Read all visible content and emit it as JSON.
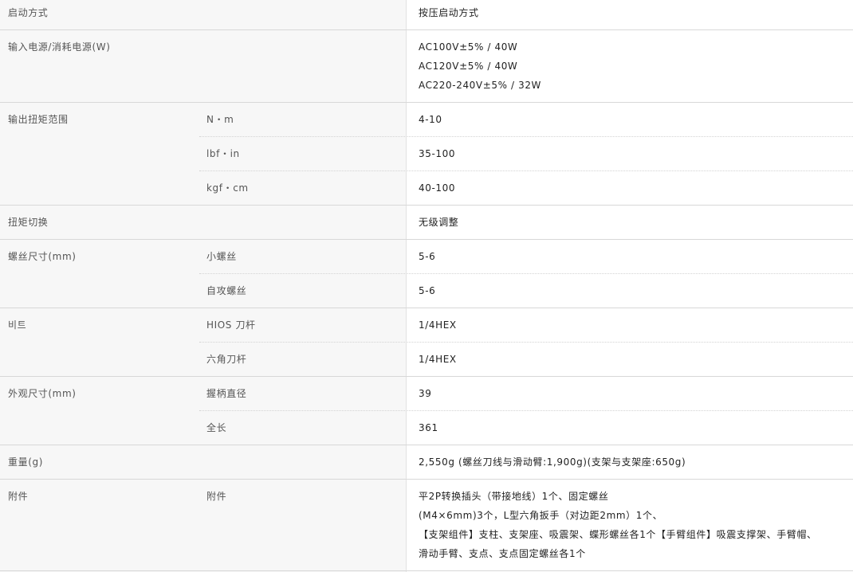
{
  "rows": {
    "start_method": {
      "label": "启动方式",
      "value": "按压启动方式"
    },
    "power": {
      "label": "输入电源/消耗电源(W)",
      "values": [
        "AC100V±5% / 40W",
        "AC120V±5% / 40W",
        "AC220-240V±5% / 32W"
      ]
    },
    "torque_range": {
      "label": "输出扭矩范围",
      "subs": [
        {
          "label": "N・m",
          "value": "4-10"
        },
        {
          "label": "lbf・in",
          "value": "35-100"
        },
        {
          "label": "kgf・cm",
          "value": "40-100"
        }
      ]
    },
    "torque_switch": {
      "label": "扭矩切换",
      "value": "无级调整"
    },
    "screw_size": {
      "label": "螺丝尺寸(mm)",
      "subs": [
        {
          "label": "小螺丝",
          "value": "5-6"
        },
        {
          "label": "自攻螺丝",
          "value": "5-6"
        }
      ]
    },
    "bit": {
      "label": "비트",
      "subs": [
        {
          "label": "HIOS 刀杆",
          "value": "1/4HEX"
        },
        {
          "label": "六角刀杆",
          "value": "1/4HEX"
        }
      ]
    },
    "dimensions": {
      "label": "外观尺寸(mm)",
      "subs": [
        {
          "label": "握柄直径",
          "value": "39"
        },
        {
          "label": "全长",
          "value": "361"
        }
      ]
    },
    "weight": {
      "label": "重量(g)",
      "value": "2,550g (螺丝刀线与滑动臂:1,900g)(支架与支架座:650g)"
    },
    "accessories": {
      "label": "附件",
      "sub_label": "附件",
      "values": [
        "平2P转换插头（带接地线）1个、固定螺丝",
        "(M4×6mm)3个，L型六角扳手（对边距2mm）1个、",
        "【支架组件】支柱、支架座、吸震架、蝶形螺丝各1个【手臂组件】吸震支撑架、手臂帽、",
        "滑动手臂、支点、支点固定螺丝各1个"
      ]
    }
  }
}
